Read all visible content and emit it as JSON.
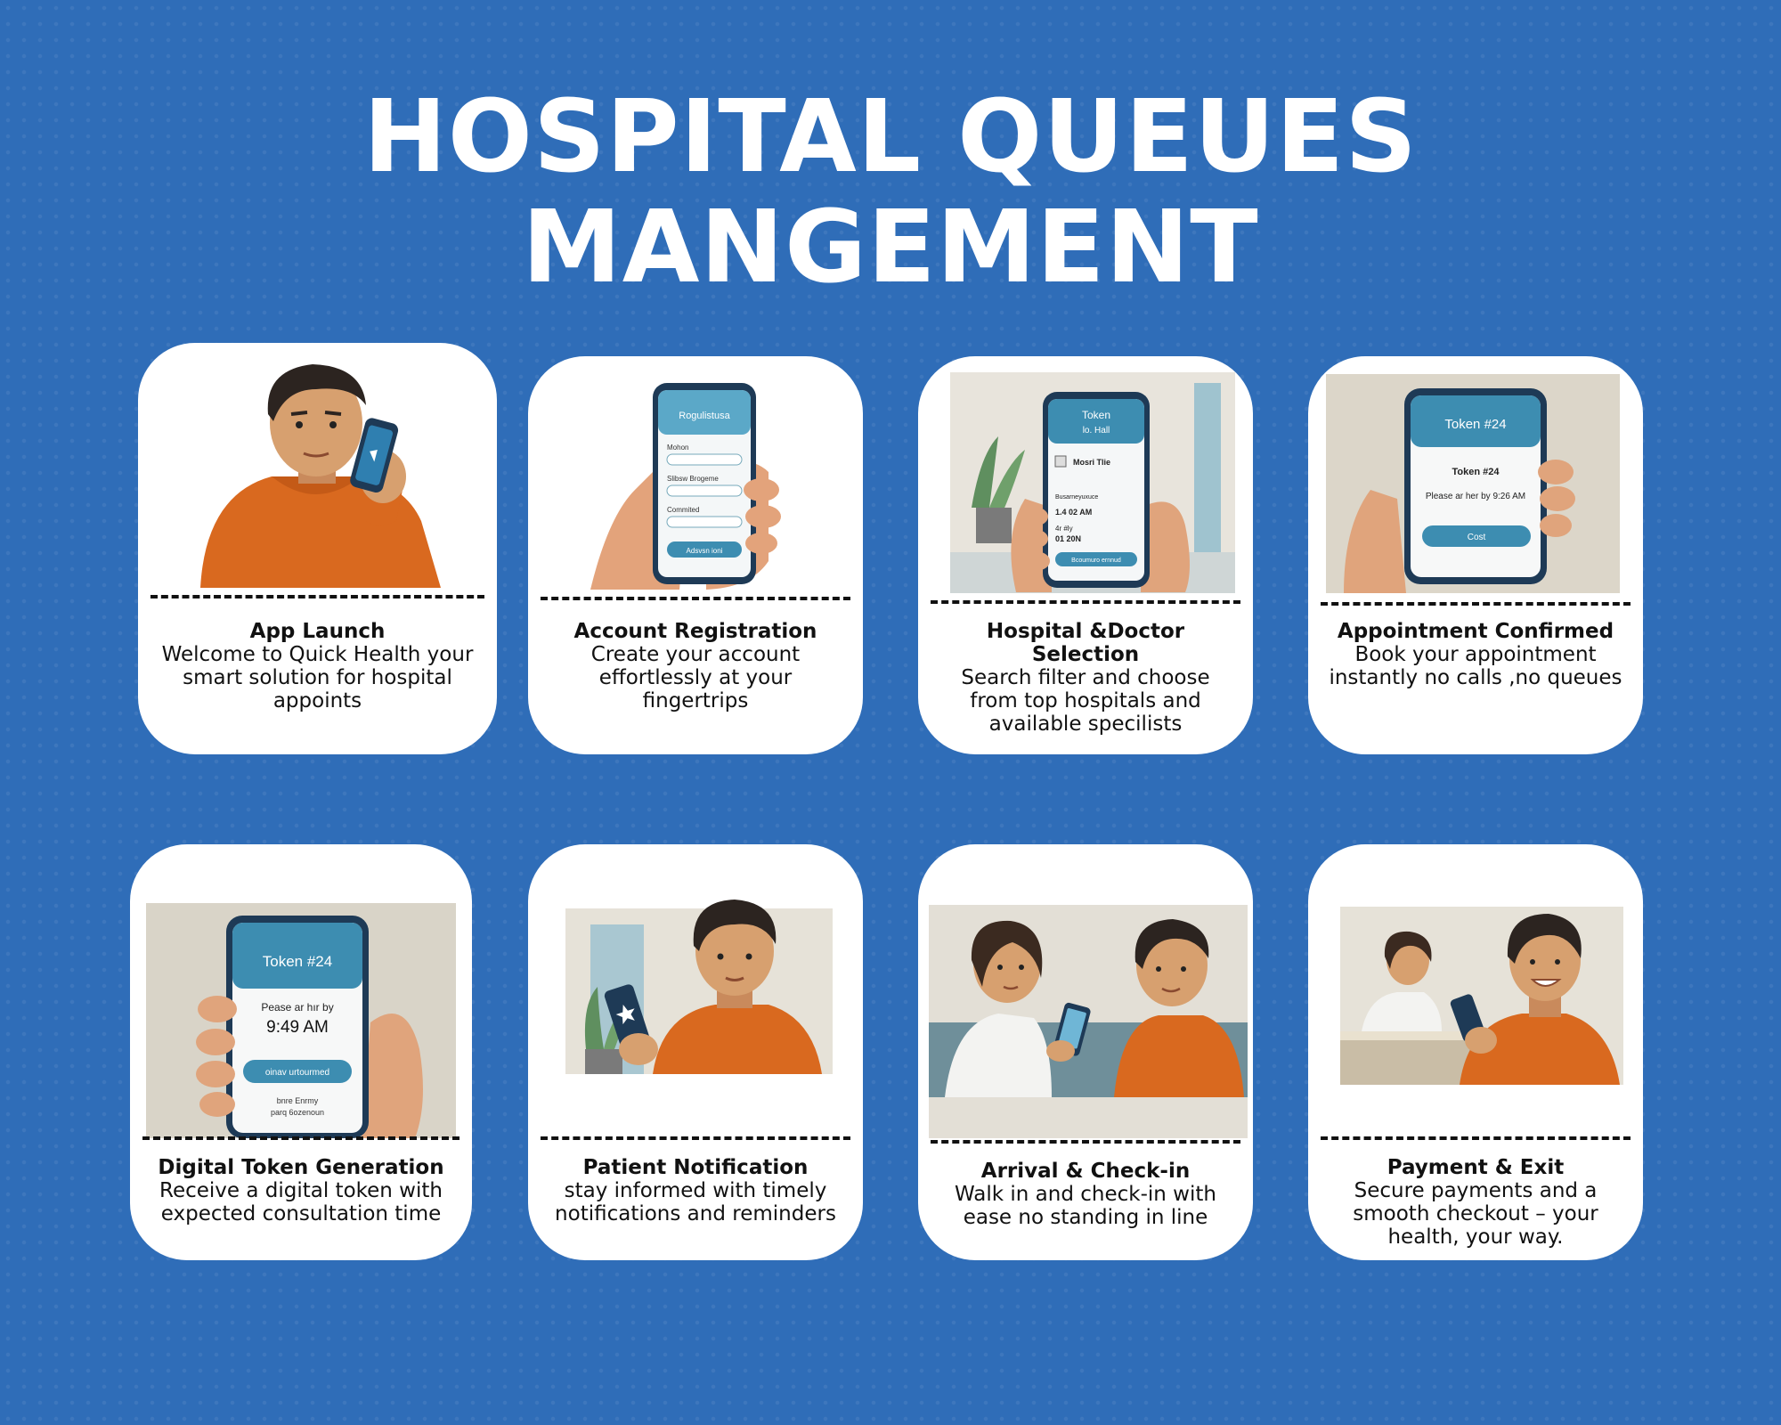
{
  "title": {
    "line1": "HOSPITAL QUEUES",
    "line2": "MANGEMENT"
  },
  "colors": {
    "background": "#2f6db8",
    "card": "#ffffff",
    "shirt": "#d9691f",
    "phone": "#1e3a56",
    "screen_header": "#3d8db1"
  },
  "cards": [
    {
      "title": "App Launch",
      "text": "Welcome to Quick Health your smart solution for hospital appoints",
      "icon": "person-with-phone-illustration"
    },
    {
      "title": "Account Registration",
      "text": "Create your account effortlessly at your fingertrips",
      "icon": "hand-holding-phone-registration-illustration",
      "phone": {
        "header": "Rogulistusa",
        "fields": [
          "Mohon",
          "Slibsw Brogeme",
          "Commited"
        ],
        "button": "Adsvsn ioni"
      }
    },
    {
      "title": "Hospital &Doctor Selection",
      "text": "Search filter and choose from top hospitals and available specilists",
      "icon": "hands-holding-phone-selection-illustration",
      "phone": {
        "header_1": "Token",
        "header_2": "lo. Hall",
        "item_1": "Mosri Tlie",
        "item_2": "Busarneyuxuce",
        "item_3": "1.4 02 AM",
        "item_4": "4r #ly",
        "item_5": "01 20N",
        "button": "Bcoumuro ernnud"
      }
    },
    {
      "title": "Appointment Confirmed",
      "text": "Book your appointment instantly no calls ,no queues",
      "icon": "hand-holding-phone-confirmed-illustration",
      "phone": {
        "header": "Token #24",
        "token": "Token #24",
        "line": "Please ar her by 9:26 AM",
        "button": "Cost"
      }
    },
    {
      "title": "Digital Token Generation",
      "text": "Receive a digital token with expected consultation time",
      "icon": "hand-holding-phone-token-illustration",
      "phone": {
        "header": "Token #24",
        "line": "Pease ar hır by",
        "time": "9:49 AM",
        "button": "oinav urtourmed",
        "foot_1": "bnre Enrmy",
        "foot_2": "parq 6ozenoun"
      }
    },
    {
      "title": "Patient Notification",
      "text": "stay informed with timely notifications and reminders",
      "icon": "person-reading-notification-illustration"
    },
    {
      "title": "Arrival & Check-in",
      "text": "Walk in and check-in with ease no standing in line",
      "icon": "doctor-and-patient-checkin-illustration"
    },
    {
      "title": "Payment & Exit",
      "text": "Secure payments and a smooth checkout – your health, your way.",
      "icon": "patient-paying-at-desk-illustration"
    }
  ]
}
